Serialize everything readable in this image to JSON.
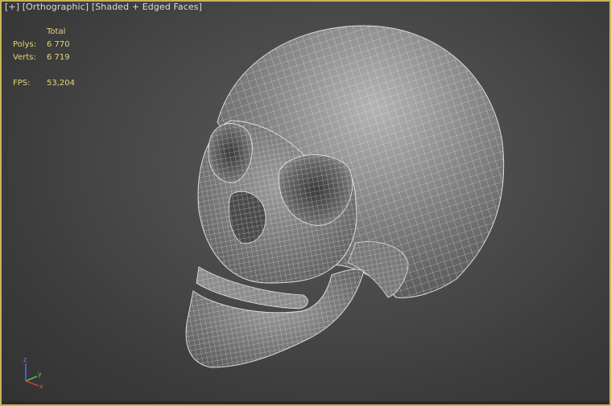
{
  "viewport": {
    "header": {
      "plus_menu": "[+]",
      "view_label": "[Orthographic]",
      "shading_label": "[Shaded + Edged Faces]"
    },
    "stats": {
      "column_header": "Total",
      "polys_label": "Polys:",
      "polys_value": "6 770",
      "verts_label": "Verts:",
      "verts_value": "6 719",
      "fps_label": "FPS:",
      "fps_value": "53,204"
    },
    "gizmo": {
      "axes": [
        "z",
        "y",
        "x"
      ]
    },
    "colors": {
      "active_border": "#c8b45a",
      "stats_text": "#e8d27a",
      "axis_x": "#d23b3b",
      "axis_y": "#4cc24c",
      "axis_z": "#4a6ee0"
    }
  }
}
